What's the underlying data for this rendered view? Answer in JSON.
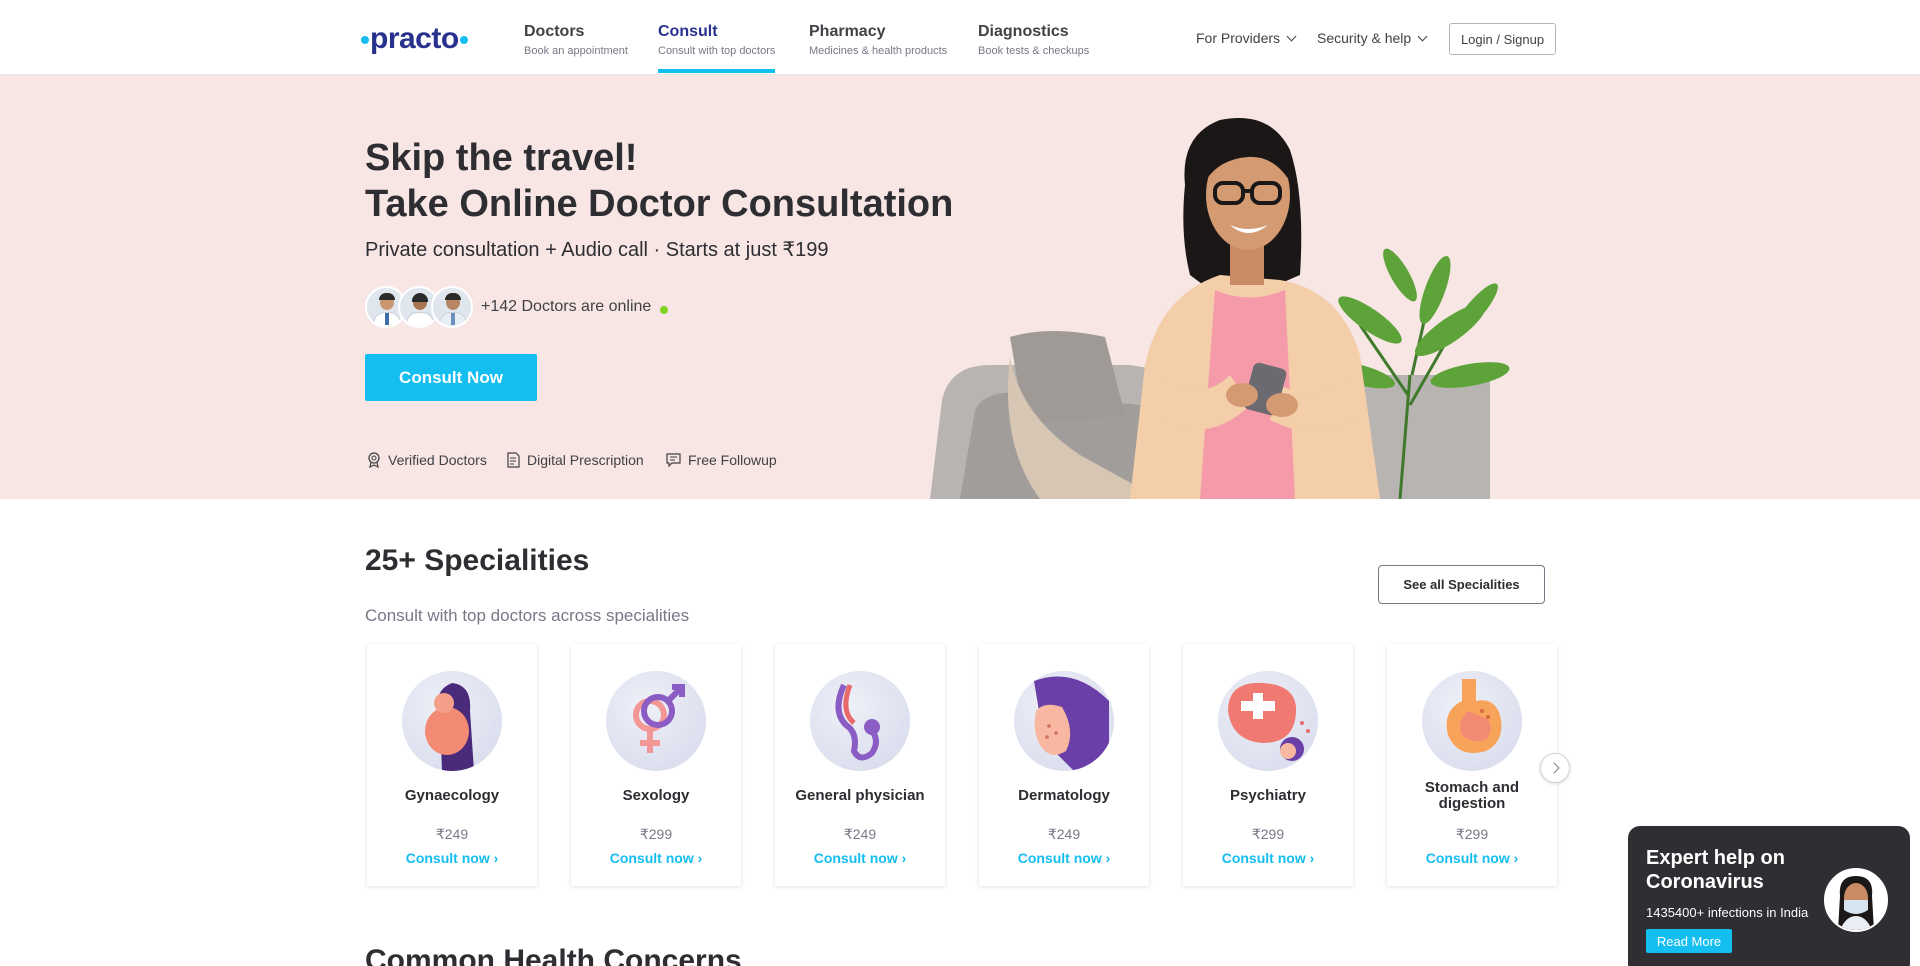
{
  "header": {
    "logo": "practo",
    "nav": [
      {
        "title": "Doctors",
        "subtitle": "Book an appointment"
      },
      {
        "title": "Consult",
        "subtitle": "Consult with top doctors"
      },
      {
        "title": "Pharmacy",
        "subtitle": "Medicines & health products"
      },
      {
        "title": "Diagnostics",
        "subtitle": "Book tests & checkups"
      }
    ],
    "active_nav": "Consult",
    "providers": "For Providers",
    "security": "Security & help",
    "login": "Login / Signup"
  },
  "hero": {
    "line1": "Skip the travel!",
    "line2": "Take Online Doctor Consultation",
    "subtitle": "Private consultation + Audio call · Starts at just ₹199",
    "online_text": "+142 Doctors are online",
    "cta": "Consult Now",
    "features": [
      "Verified Doctors",
      "Digital Prescription",
      "Free Followup"
    ],
    "feature_icons": [
      "badge-icon",
      "prescription-icon",
      "chat-icon"
    ]
  },
  "specialities": {
    "title": "25+ Specialities",
    "subtitle": "Consult with top doctors across specialities",
    "see_all": "See all Specialities",
    "cards": [
      {
        "name": "Gynaecology",
        "price": "₹249",
        "cta": "Consult now",
        "icon": "pregnant-woman-icon"
      },
      {
        "name": "Sexology",
        "price": "₹299",
        "cta": "Consult now",
        "icon": "gender-symbols-icon"
      },
      {
        "name": "General physician",
        "price": "₹249",
        "cta": "Consult now",
        "icon": "stethoscope-icon"
      },
      {
        "name": "Dermatology",
        "price": "₹249",
        "cta": "Consult now",
        "icon": "face-skin-icon"
      },
      {
        "name": "Psychiatry",
        "price": "₹299",
        "cta": "Consult now",
        "icon": "mental-health-icon"
      },
      {
        "name": "Stomach and digestion",
        "price": "₹299",
        "cta": "Consult now",
        "icon": "stomach-icon"
      }
    ]
  },
  "concerns": {
    "title": "Common Health Concerns"
  },
  "covid_widget": {
    "title": "Expert help on Coronavirus",
    "stat": "1435400+ infections in India",
    "cta": "Read More"
  },
  "colors": {
    "brand": "#14bef0",
    "navy": "#28328c",
    "hero_bg": "#f7e6e3",
    "online": "#7ed321"
  }
}
